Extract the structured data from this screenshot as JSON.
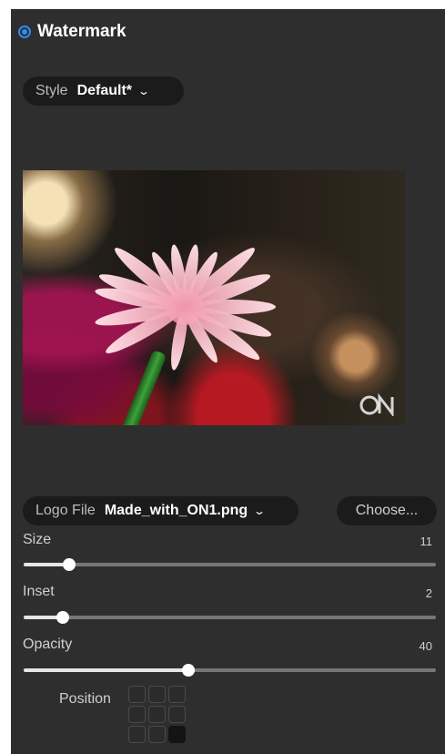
{
  "header": {
    "title": "Watermark"
  },
  "style": {
    "label": "Style",
    "value": "Default*"
  },
  "logo_file": {
    "label": "Logo File",
    "value": "Made_with_ON1.png",
    "choose_label": "Choose..."
  },
  "sliders": [
    {
      "label": "Size",
      "value": "11",
      "fraction": 0.11
    },
    {
      "label": "Inset",
      "value": "2",
      "fraction": 0.095
    },
    {
      "label": "Opacity",
      "value": "40",
      "fraction": 0.4
    }
  ],
  "position": {
    "label": "Position",
    "selected_index": 8
  },
  "colors": {
    "accent": "#2e8cf0",
    "panel": "#2e2e2e",
    "pill": "#1b1b1b"
  }
}
